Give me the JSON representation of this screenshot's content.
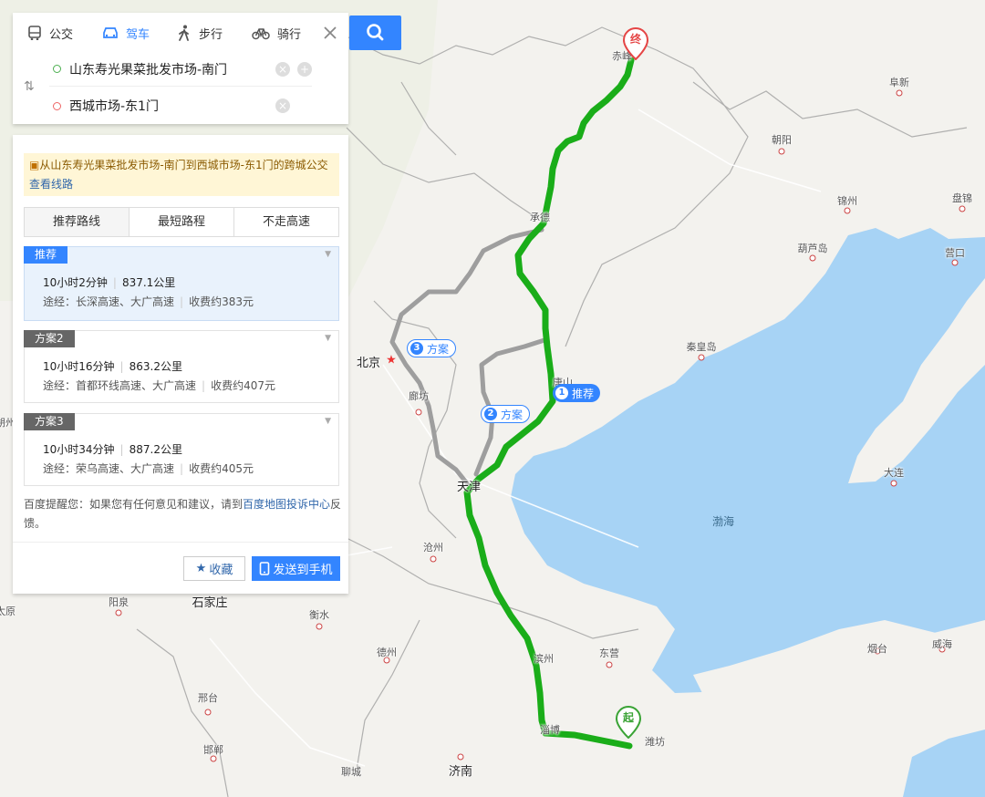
{
  "mode_tabs": [
    {
      "label": "公交",
      "icon": "bus-icon"
    },
    {
      "label": "驾车",
      "icon": "car-icon"
    },
    {
      "label": "步行",
      "icon": "walk-icon"
    },
    {
      "label": "骑行",
      "icon": "bike-icon"
    }
  ],
  "search": {
    "start_value": "山东寿光果菜批发市场-南门",
    "end_value": "西城市场-东1门"
  },
  "notice": {
    "text": "从山东寿光果菜批发市场-南门到西城市场-东1门的跨城公交",
    "link": "查看线路"
  },
  "strategy_tabs": [
    "推荐路线",
    "最短路程",
    "不走高速"
  ],
  "plans": [
    {
      "badge": "推荐",
      "duration": "10小时2分钟",
      "distance": "837.1公里",
      "via": "途经：长深高速、大广高速",
      "toll": "收费约383元"
    },
    {
      "badge": "方案2",
      "duration": "10小时16分钟",
      "distance": "863.2公里",
      "via": "途经：首都环线高速、大广高速",
      "toll": "收费约407元"
    },
    {
      "badge": "方案3",
      "duration": "10小时34分钟",
      "distance": "887.2公里",
      "via": "途经：荣乌高速、大广高速",
      "toll": "收费约405元"
    }
  ],
  "feedback": {
    "text_before": "百度提醒您：如果您有任何意见和建议，请到",
    "link": "百度地图投诉中心",
    "text_after": "反馈。"
  },
  "actions": {
    "favorite": "收藏",
    "send": "发送到手机"
  },
  "map": {
    "cities": {
      "chifeng": "赤峰",
      "fuxin": "阜新",
      "chaoyang": "朝阳",
      "jinzhou": "锦州",
      "panjin": "盘锦",
      "huludao": "葫芦岛",
      "yingkou": "营口",
      "chengde": "承德",
      "qinhuangdao": "秦皇岛",
      "tangshan": "唐山",
      "beijing": "北京",
      "langfang": "廊坊",
      "tianjin": "天津",
      "dalian": "大连",
      "cangzhou": "沧州",
      "yangquan": "阳泉",
      "shijiazhuang": "石家庄",
      "hengshui": "衡水",
      "dezhou": "德州",
      "binzhou": "滨州",
      "dongying": "东营",
      "yantai": "烟台",
      "weihai": "威海",
      "xingtai": "邢台",
      "zibo": "淄博",
      "weifang": "潍坊",
      "handan": "邯郸",
      "liaocheng": "聊城",
      "jinan": "济南",
      "taiyuan": "太原",
      "shuozhou": "朔州",
      "bohai": "渤海"
    },
    "route_tags": [
      {
        "num": "1",
        "label": "推荐"
      },
      {
        "num": "2",
        "label": "方案"
      },
      {
        "num": "3",
        "label": "方案"
      }
    ],
    "pins": {
      "start": "起",
      "end": "终"
    },
    "colors": {
      "route_recommended": "#1aad19",
      "route_alt": "#9e9e9e",
      "sea": "#a7d3f5",
      "accent": "#3385ff"
    }
  }
}
